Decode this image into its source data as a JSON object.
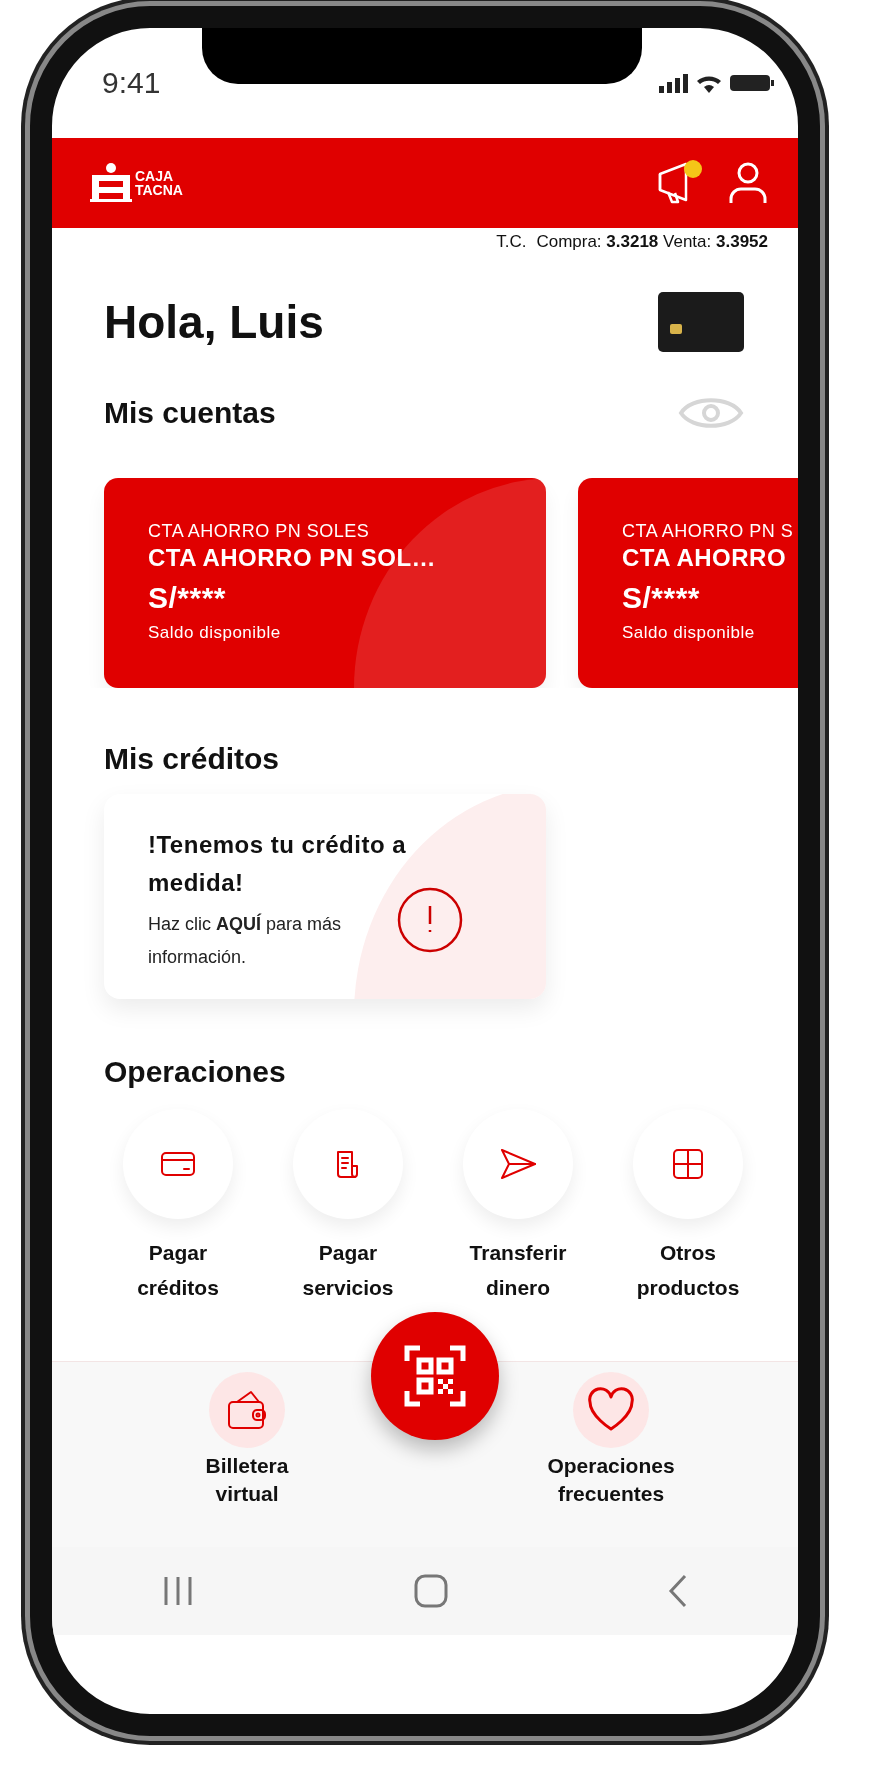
{
  "status_bar": {
    "time": "9:41"
  },
  "header": {
    "brand_line_1": "CAJA",
    "brand_line_2": "TACNA",
    "has_notification": true
  },
  "exchange_rate": {
    "label": "T.C.",
    "text": "Compra: **3.3218** Venta: **3.3952**"
  },
  "greeting": "Hola, Luis",
  "accounts": {
    "title": "Mis cuentas",
    "items": [
      {
        "type": "CTA AHORRO PN SOLES",
        "name": "CTA AHORRO PN SOL…",
        "balance": "S/****",
        "balance_label": "Saldo disponible"
      },
      {
        "type": "CTA AHORRO PN S",
        "name": "CTA AHORRO",
        "balance": "S/****",
        "balance_label": "Saldo disponible"
      }
    ]
  },
  "credits": {
    "title": "Mis créditos",
    "promo_title": "!Tenemos tu crédito a medida!",
    "promo_text": "Haz clic **AQUÍ** para más información."
  },
  "operations": {
    "title": "Operaciones",
    "items": [
      {
        "kind": "card",
        "label": "Pagar créditos"
      },
      {
        "kind": "receipt",
        "label": "Pagar servicios"
      },
      {
        "kind": "send",
        "label": "Transferir dinero"
      },
      {
        "kind": "grid",
        "label": "Otros productos"
      }
    ]
  },
  "bottom_nav": {
    "items": [
      {
        "kind": "wallet",
        "label": "Billetera virtual"
      },
      {
        "kind": "heart",
        "label": "Operaciones frecuentes"
      }
    ]
  }
}
